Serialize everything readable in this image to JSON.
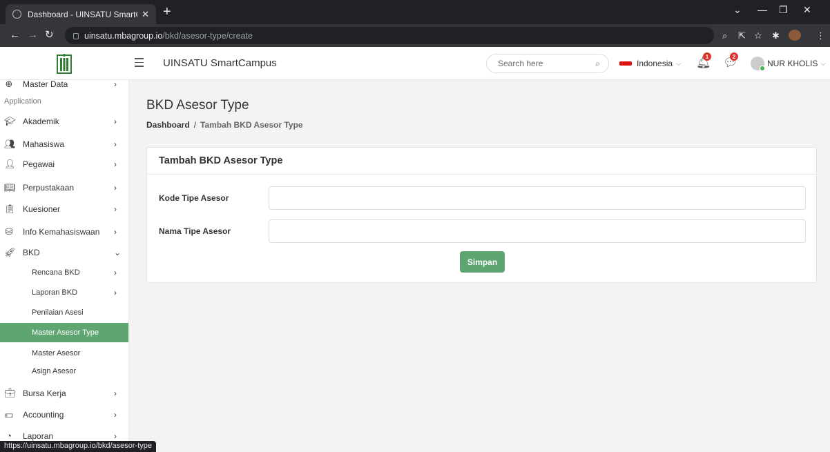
{
  "browser": {
    "tab_title": "Dashboard - UINSATU SmartCam",
    "tab_close": "✕",
    "new_tab": "+",
    "url_domain": "uinsatu.mbagroup.io",
    "url_path": "/bkd/asesor-type/create",
    "status_url": "https://uinsatu.mbagroup.io/bkd/asesor-type"
  },
  "header": {
    "app_title": "UINSATU SmartCampus",
    "search_placeholder": "Search here",
    "language": "Indonesia",
    "notification_count": "1",
    "message_count": "2",
    "user_name": "NUR KHOLIS"
  },
  "sidebar": {
    "partial_item": "Master Data",
    "section_label": "Application",
    "items": [
      {
        "label": "Akademik",
        "icon": "graduation-cap-icon"
      },
      {
        "label": "Mahasiswa",
        "icon": "users-icon"
      },
      {
        "label": "Pegawai",
        "icon": "user-icon"
      },
      {
        "label": "Perpustakaan",
        "icon": "book-icon"
      },
      {
        "label": "Kuesioner",
        "icon": "clipboard-icon"
      },
      {
        "label": "Info Kemahasiswaan",
        "icon": "info-icon"
      },
      {
        "label": "BKD",
        "icon": "rocket-icon"
      }
    ],
    "bkd_subitems": [
      {
        "label": "Rencana BKD"
      },
      {
        "label": "Laporan BKD"
      },
      {
        "label": "Penilaian Asesi"
      },
      {
        "label": "Master Asesor Type"
      },
      {
        "label": "Master Asesor"
      },
      {
        "label": "Asign Asesor"
      }
    ],
    "items_after": [
      {
        "label": "Bursa Kerja",
        "icon": "briefcase-icon"
      },
      {
        "label": "Accounting",
        "icon": "money-icon"
      },
      {
        "label": "Laporan",
        "icon": "pie-chart-icon"
      }
    ]
  },
  "main": {
    "page_title": "BKD Asesor Type",
    "breadcrumb_home": "Dashboard",
    "breadcrumb_sep": "/",
    "breadcrumb_current": "Tambah BKD Asesor Type",
    "card_title": "Tambah BKD Asesor Type",
    "field_kode_label": "Kode Tipe Asesor",
    "field_kode_value": "",
    "field_nama_label": "Nama Tipe Asesor",
    "field_nama_value": "",
    "save_label": "Simpan"
  },
  "colors": {
    "accent_green": "#5ea572",
    "badge_red": "#e0322e",
    "browser_dark": "#202124"
  }
}
